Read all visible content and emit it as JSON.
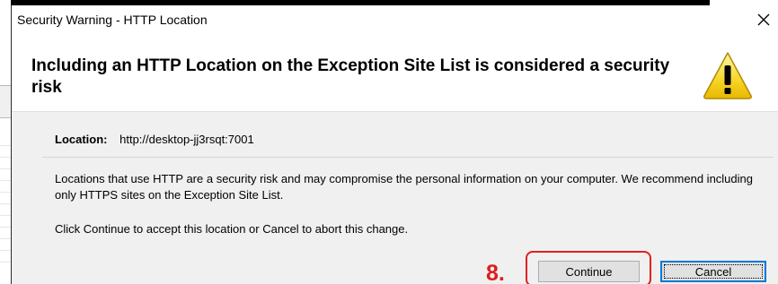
{
  "dialog": {
    "title": "Security Warning - HTTP Location",
    "close_glyph": "✕",
    "headline": "Including an HTTP Location on the Exception Site List is considered a security risk",
    "warning_icon": "warning-triangle-icon",
    "location_label": "Location:",
    "location_value": "http://desktop-jj3rsqt:7001",
    "paragraph1": "Locations that use HTTP are a security risk and may compromise the personal information on your computer.  We recommend including only HTTPS sites on the Exception Site List.",
    "paragraph2": "Click Continue to accept this location or Cancel to abort this change.",
    "continue_label": "Continue",
    "cancel_label": "Cancel"
  },
  "annotation": {
    "step_label": "8.",
    "color": "#e02020"
  }
}
